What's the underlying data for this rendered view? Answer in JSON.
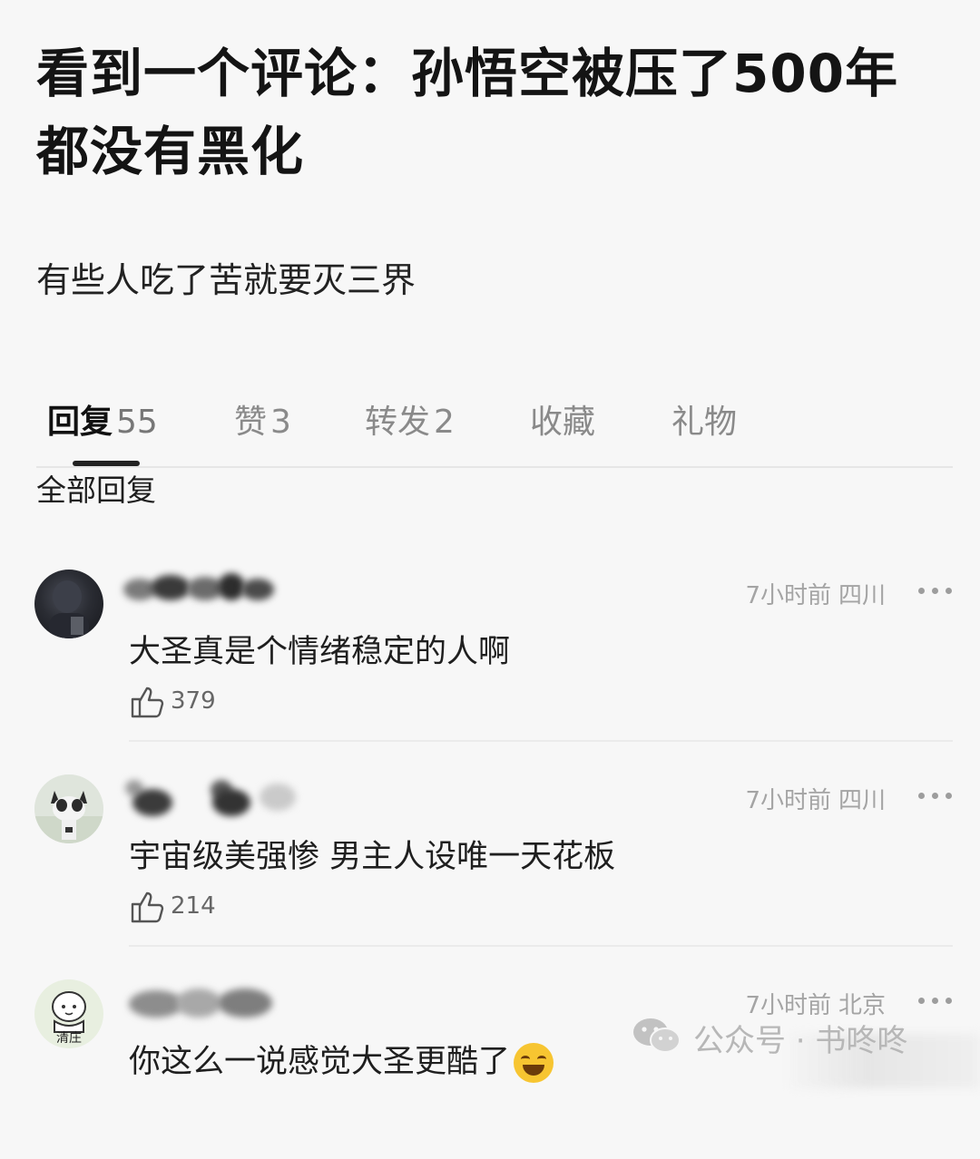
{
  "post": {
    "title": "看到一个评论：孙悟空被压了500年都没有黑化",
    "body": "有些人吃了苦就要灭三界"
  },
  "tabs": [
    {
      "label": "回复",
      "count": "55",
      "active": true
    },
    {
      "label": "赞",
      "count": "3"
    },
    {
      "label": "转发",
      "count": "2"
    },
    {
      "label": "收藏",
      "count": ""
    },
    {
      "label": "礼物",
      "count": ""
    }
  ],
  "section_label": "全部回复",
  "comments": [
    {
      "time": "7小时前",
      "location": "四川",
      "text": "大圣真是个情绪稳定的人啊",
      "likes": "379",
      "avatar_icon": "dark-photo-avatar"
    },
    {
      "time": "7小时前",
      "location": "四川",
      "text": "宇宙级美强惨 男主人设唯一天花板",
      "likes": "214",
      "avatar_icon": "cat-avatar"
    },
    {
      "time": "7小时前",
      "location": "北京",
      "text": "你这么一说感觉大圣更酷了",
      "emoji": "laughing-tears-emoji",
      "avatar_icon": "cartoon-avatar",
      "avatar_caption": "清庄"
    }
  ],
  "watermark": {
    "text": "公众号 · 书咚咚",
    "icon": "wechat-icon"
  },
  "colors": {
    "background": "#f7f7f7",
    "title": "#141414",
    "meta": "#a4a4a4",
    "tab_inactive": "#8a8a8a"
  }
}
